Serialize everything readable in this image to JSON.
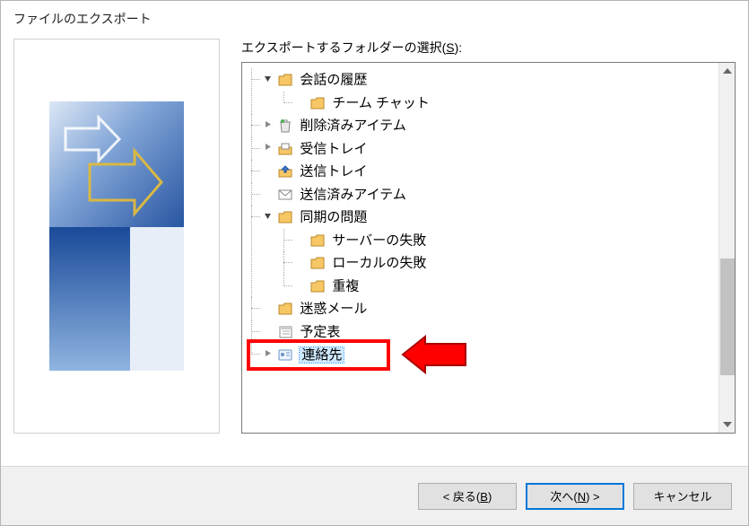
{
  "dialog": {
    "title": "ファイルのエクスポート"
  },
  "folder_select": {
    "label_pre": "エクスポートするフォルダーの選択(",
    "label_key": "S",
    "label_post": "):"
  },
  "tree": {
    "conv_history": "会話の履歴",
    "team_chat": "チーム チャット",
    "deleted_items": "削除済みアイテム",
    "inbox": "受信トレイ",
    "outbox": "送信トレイ",
    "sent_items": "送信済みアイテム",
    "sync_issues": "同期の問題",
    "server_fail": "サーバーの失敗",
    "local_fail": "ローカルの失敗",
    "conflict": "重複",
    "junk": "迷惑メール",
    "calendar": "予定表",
    "contacts": "連絡先"
  },
  "buttons": {
    "back_pre": "< 戻る(",
    "back_key": "B",
    "back_post": ")",
    "next_pre": "次へ(",
    "next_key": "N",
    "next_post": ") >",
    "cancel": "キャンセル"
  }
}
